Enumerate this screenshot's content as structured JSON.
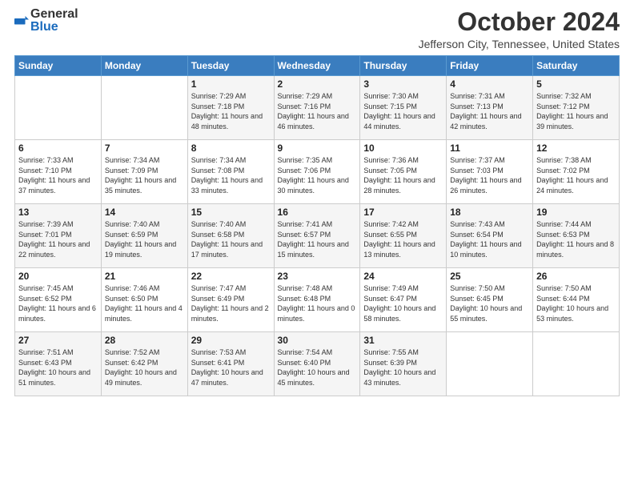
{
  "header": {
    "logo_general": "General",
    "logo_blue": "Blue",
    "title": "October 2024",
    "location": "Jefferson City, Tennessee, United States"
  },
  "weekdays": [
    "Sunday",
    "Monday",
    "Tuesday",
    "Wednesday",
    "Thursday",
    "Friday",
    "Saturday"
  ],
  "weeks": [
    [
      {
        "day": "",
        "sunrise": "",
        "sunset": "",
        "daylight": ""
      },
      {
        "day": "",
        "sunrise": "",
        "sunset": "",
        "daylight": ""
      },
      {
        "day": "1",
        "sunrise": "Sunrise: 7:29 AM",
        "sunset": "Sunset: 7:18 PM",
        "daylight": "Daylight: 11 hours and 48 minutes."
      },
      {
        "day": "2",
        "sunrise": "Sunrise: 7:29 AM",
        "sunset": "Sunset: 7:16 PM",
        "daylight": "Daylight: 11 hours and 46 minutes."
      },
      {
        "day": "3",
        "sunrise": "Sunrise: 7:30 AM",
        "sunset": "Sunset: 7:15 PM",
        "daylight": "Daylight: 11 hours and 44 minutes."
      },
      {
        "day": "4",
        "sunrise": "Sunrise: 7:31 AM",
        "sunset": "Sunset: 7:13 PM",
        "daylight": "Daylight: 11 hours and 42 minutes."
      },
      {
        "day": "5",
        "sunrise": "Sunrise: 7:32 AM",
        "sunset": "Sunset: 7:12 PM",
        "daylight": "Daylight: 11 hours and 39 minutes."
      }
    ],
    [
      {
        "day": "6",
        "sunrise": "Sunrise: 7:33 AM",
        "sunset": "Sunset: 7:10 PM",
        "daylight": "Daylight: 11 hours and 37 minutes."
      },
      {
        "day": "7",
        "sunrise": "Sunrise: 7:34 AM",
        "sunset": "Sunset: 7:09 PM",
        "daylight": "Daylight: 11 hours and 35 minutes."
      },
      {
        "day": "8",
        "sunrise": "Sunrise: 7:34 AM",
        "sunset": "Sunset: 7:08 PM",
        "daylight": "Daylight: 11 hours and 33 minutes."
      },
      {
        "day": "9",
        "sunrise": "Sunrise: 7:35 AM",
        "sunset": "Sunset: 7:06 PM",
        "daylight": "Daylight: 11 hours and 30 minutes."
      },
      {
        "day": "10",
        "sunrise": "Sunrise: 7:36 AM",
        "sunset": "Sunset: 7:05 PM",
        "daylight": "Daylight: 11 hours and 28 minutes."
      },
      {
        "day": "11",
        "sunrise": "Sunrise: 7:37 AM",
        "sunset": "Sunset: 7:03 PM",
        "daylight": "Daylight: 11 hours and 26 minutes."
      },
      {
        "day": "12",
        "sunrise": "Sunrise: 7:38 AM",
        "sunset": "Sunset: 7:02 PM",
        "daylight": "Daylight: 11 hours and 24 minutes."
      }
    ],
    [
      {
        "day": "13",
        "sunrise": "Sunrise: 7:39 AM",
        "sunset": "Sunset: 7:01 PM",
        "daylight": "Daylight: 11 hours and 22 minutes."
      },
      {
        "day": "14",
        "sunrise": "Sunrise: 7:40 AM",
        "sunset": "Sunset: 6:59 PM",
        "daylight": "Daylight: 11 hours and 19 minutes."
      },
      {
        "day": "15",
        "sunrise": "Sunrise: 7:40 AM",
        "sunset": "Sunset: 6:58 PM",
        "daylight": "Daylight: 11 hours and 17 minutes."
      },
      {
        "day": "16",
        "sunrise": "Sunrise: 7:41 AM",
        "sunset": "Sunset: 6:57 PM",
        "daylight": "Daylight: 11 hours and 15 minutes."
      },
      {
        "day": "17",
        "sunrise": "Sunrise: 7:42 AM",
        "sunset": "Sunset: 6:55 PM",
        "daylight": "Daylight: 11 hours and 13 minutes."
      },
      {
        "day": "18",
        "sunrise": "Sunrise: 7:43 AM",
        "sunset": "Sunset: 6:54 PM",
        "daylight": "Daylight: 11 hours and 10 minutes."
      },
      {
        "day": "19",
        "sunrise": "Sunrise: 7:44 AM",
        "sunset": "Sunset: 6:53 PM",
        "daylight": "Daylight: 11 hours and 8 minutes."
      }
    ],
    [
      {
        "day": "20",
        "sunrise": "Sunrise: 7:45 AM",
        "sunset": "Sunset: 6:52 PM",
        "daylight": "Daylight: 11 hours and 6 minutes."
      },
      {
        "day": "21",
        "sunrise": "Sunrise: 7:46 AM",
        "sunset": "Sunset: 6:50 PM",
        "daylight": "Daylight: 11 hours and 4 minutes."
      },
      {
        "day": "22",
        "sunrise": "Sunrise: 7:47 AM",
        "sunset": "Sunset: 6:49 PM",
        "daylight": "Daylight: 11 hours and 2 minutes."
      },
      {
        "day": "23",
        "sunrise": "Sunrise: 7:48 AM",
        "sunset": "Sunset: 6:48 PM",
        "daylight": "Daylight: 11 hours and 0 minutes."
      },
      {
        "day": "24",
        "sunrise": "Sunrise: 7:49 AM",
        "sunset": "Sunset: 6:47 PM",
        "daylight": "Daylight: 10 hours and 58 minutes."
      },
      {
        "day": "25",
        "sunrise": "Sunrise: 7:50 AM",
        "sunset": "Sunset: 6:45 PM",
        "daylight": "Daylight: 10 hours and 55 minutes."
      },
      {
        "day": "26",
        "sunrise": "Sunrise: 7:50 AM",
        "sunset": "Sunset: 6:44 PM",
        "daylight": "Daylight: 10 hours and 53 minutes."
      }
    ],
    [
      {
        "day": "27",
        "sunrise": "Sunrise: 7:51 AM",
        "sunset": "Sunset: 6:43 PM",
        "daylight": "Daylight: 10 hours and 51 minutes."
      },
      {
        "day": "28",
        "sunrise": "Sunrise: 7:52 AM",
        "sunset": "Sunset: 6:42 PM",
        "daylight": "Daylight: 10 hours and 49 minutes."
      },
      {
        "day": "29",
        "sunrise": "Sunrise: 7:53 AM",
        "sunset": "Sunset: 6:41 PM",
        "daylight": "Daylight: 10 hours and 47 minutes."
      },
      {
        "day": "30",
        "sunrise": "Sunrise: 7:54 AM",
        "sunset": "Sunset: 6:40 PM",
        "daylight": "Daylight: 10 hours and 45 minutes."
      },
      {
        "day": "31",
        "sunrise": "Sunrise: 7:55 AM",
        "sunset": "Sunset: 6:39 PM",
        "daylight": "Daylight: 10 hours and 43 minutes."
      },
      {
        "day": "",
        "sunrise": "",
        "sunset": "",
        "daylight": ""
      },
      {
        "day": "",
        "sunrise": "",
        "sunset": "",
        "daylight": ""
      }
    ]
  ]
}
